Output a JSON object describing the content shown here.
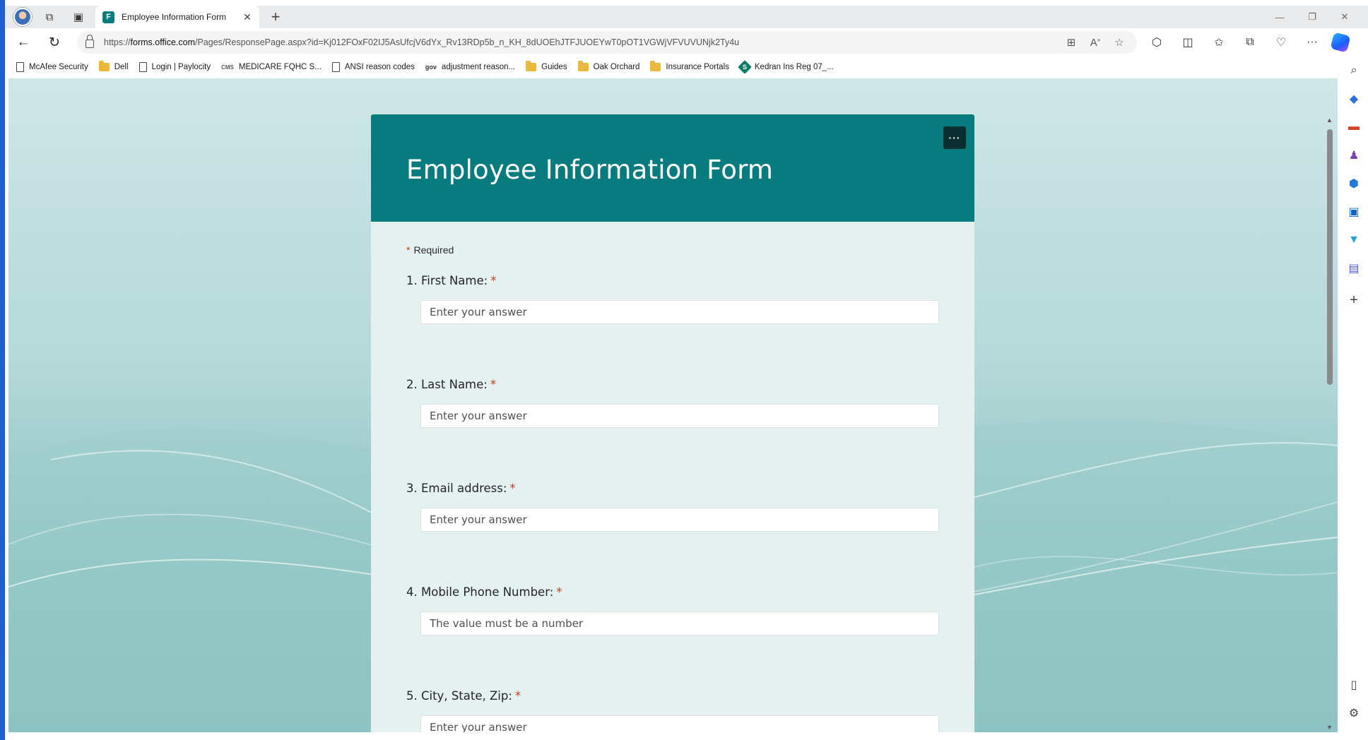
{
  "browser": {
    "tab": {
      "title": "Employee Information Form",
      "icon": "forms-icon"
    },
    "address": {
      "prefix": "https://",
      "host": "forms.office.com",
      "path": "/Pages/ResponsePage.aspx?id=Kj012FOxF02IJ5AsUfcjV6dYx_Rv13RDp5b_n_KH_8dUOEhJTFJUOEYwT0pOT1VGWjVFVUVUNjk2Ty4u"
    },
    "favorites": [
      {
        "label": "McAfee Security",
        "icon": "page"
      },
      {
        "label": "Dell",
        "icon": "folder"
      },
      {
        "label": "Login | Paylocity",
        "icon": "page"
      },
      {
        "label": "MEDICARE FQHC S...",
        "icon": "cms"
      },
      {
        "label": "ANSI reason codes",
        "icon": "page"
      },
      {
        "label": "adjustment reason...",
        "icon": "gov"
      },
      {
        "label": "Guides",
        "icon": "folder"
      },
      {
        "label": "Oak Orchard",
        "icon": "folder"
      },
      {
        "label": "Insurance Portals",
        "icon": "folder"
      },
      {
        "label": "Kedran Ins Reg 07_...",
        "icon": "sharepoint"
      }
    ]
  },
  "form": {
    "title": "Employee Information Form",
    "required_note": "Required",
    "questions": [
      {
        "label": "1. First Name:",
        "placeholder": "Enter your answer"
      },
      {
        "label": "2. Last Name:",
        "placeholder": "Enter your answer"
      },
      {
        "label": "3. Email address:",
        "placeholder": "Enter your answer"
      },
      {
        "label": "4. Mobile Phone Number:",
        "placeholder": "The value must be a number"
      },
      {
        "label": "5. City, State, Zip:",
        "placeholder": "Enter your answer"
      }
    ]
  },
  "colors": {
    "header": "#077b7d",
    "required": "#c43e1c",
    "background": "#a9d2d1"
  }
}
